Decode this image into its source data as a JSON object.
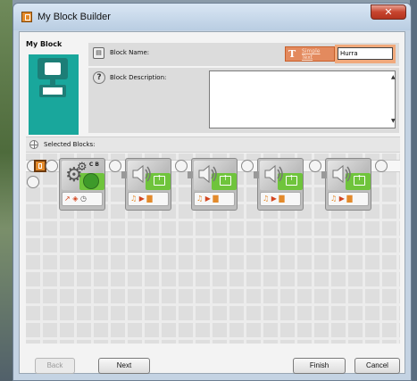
{
  "window": {
    "title": "My Block Builder",
    "close_glyph": "✕"
  },
  "my_block": {
    "heading": "My Block"
  },
  "block_name": {
    "label": "Block Name:",
    "text_mode_label": "Simple Text",
    "text_mode_glyph": "T",
    "value": "Hurra"
  },
  "block_description": {
    "label": "Block Description:",
    "help_glyph": "?",
    "value": "",
    "scroll_up_glyph": "▲",
    "scroll_down_glyph": "▼"
  },
  "selected_blocks": {
    "label": "Selected Blocks:",
    "blocks": [
      {
        "type": "move-block",
        "icon": "gears-icon",
        "ports": "C B",
        "color": "#6fc43c"
      },
      {
        "type": "sound-block",
        "icon": "speaker-icon",
        "color": "#6fc43c"
      },
      {
        "type": "sound-block",
        "icon": "speaker-icon",
        "color": "#6fc43c"
      },
      {
        "type": "sound-block",
        "icon": "speaker-icon",
        "color": "#6fc43c"
      },
      {
        "type": "sound-block",
        "icon": "speaker-icon",
        "color": "#6fc43c"
      }
    ]
  },
  "buttons": {
    "back": "Back",
    "next": "Next",
    "finish": "Finish",
    "cancel": "Cancel"
  },
  "colors": {
    "accent": "#e38a5e",
    "block_green": "#6fc43c",
    "block_icon_teal": "#19a79c"
  }
}
